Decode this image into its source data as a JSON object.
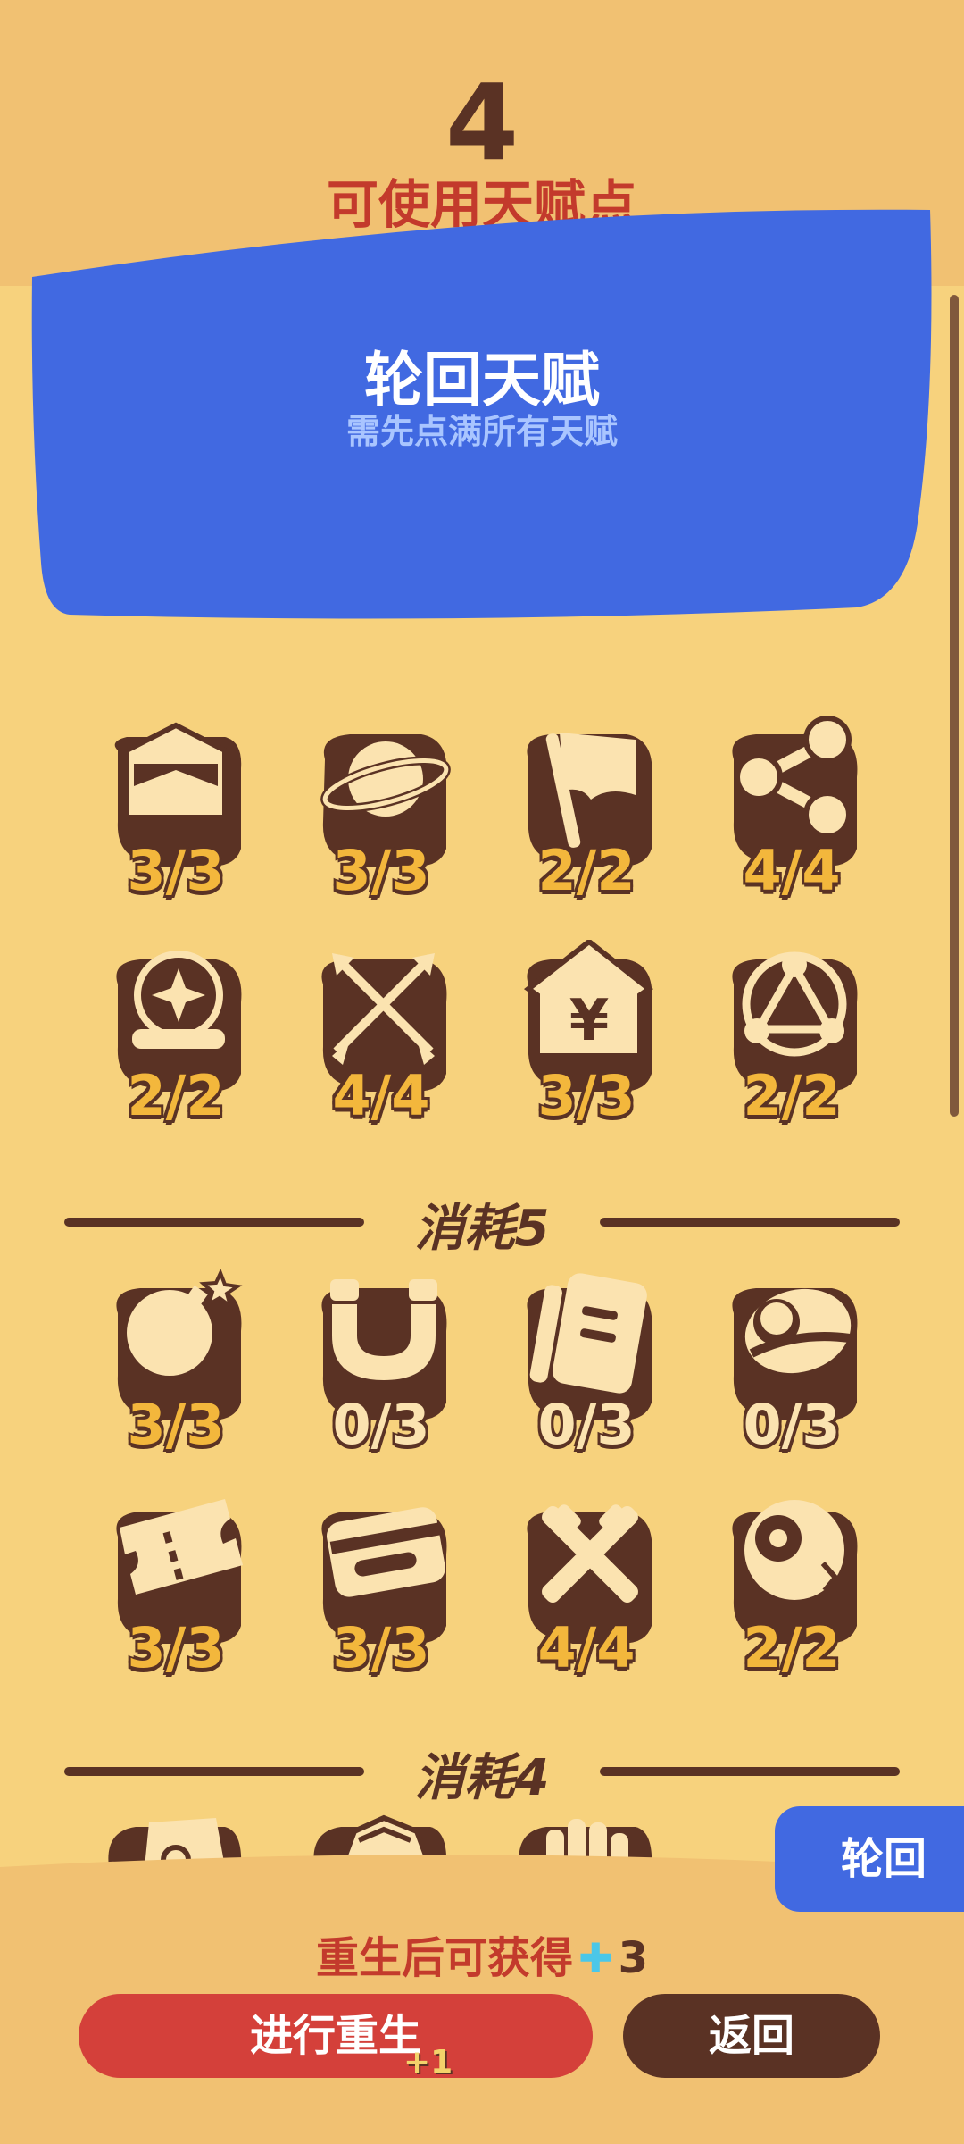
{
  "header": {
    "points": "4",
    "points_label": "可使用天赋点"
  },
  "banner": {
    "title": "轮回天赋",
    "subtitle": "需先点满所有天赋"
  },
  "sections": [
    {
      "label": "",
      "talents": [
        {
          "icon": "envelope-icon",
          "count": "3/3"
        },
        {
          "icon": "planet-icon",
          "count": "3/3"
        },
        {
          "icon": "flag-icon",
          "count": "2/2"
        },
        {
          "icon": "share-icon",
          "count": "4/4"
        },
        {
          "icon": "crystal-ball-icon",
          "count": "2/2"
        },
        {
          "icon": "crossed-arrows-icon",
          "count": "4/4"
        },
        {
          "icon": "yen-house-icon",
          "count": "3/3"
        },
        {
          "icon": "triangle-nodes-icon",
          "count": "2/2"
        }
      ]
    },
    {
      "label": "消耗5",
      "talents": [
        {
          "icon": "bomb-icon",
          "count": "3/3"
        },
        {
          "icon": "magnet-icon",
          "count": "0/3"
        },
        {
          "icon": "notebook-icon",
          "count": "0/3"
        },
        {
          "icon": "meditation-icon",
          "count": "0/3"
        },
        {
          "icon": "ticket-icon",
          "count": "3/3"
        },
        {
          "icon": "card-icon",
          "count": "3/3"
        },
        {
          "icon": "crossed-swords-icon",
          "count": "4/4"
        },
        {
          "icon": "eyeball-icon",
          "count": "2/2"
        }
      ]
    },
    {
      "label": "消耗4",
      "talents": []
    }
  ],
  "footer": {
    "reward_prefix": "重生后可获得",
    "reward_icon": "plus-icon",
    "reward_value": "3",
    "rebirth_button": "进行重生",
    "back_button": "返回",
    "float_text": "+1",
    "side_tab": "轮回"
  },
  "colors": {
    "background": "#f7d27d",
    "banner": "#4169e1",
    "icon_dark": "#5a3224",
    "icon_light": "#fbe3b0",
    "count_gold": "#f3b73c",
    "rebirth_red": "#d4403a"
  }
}
